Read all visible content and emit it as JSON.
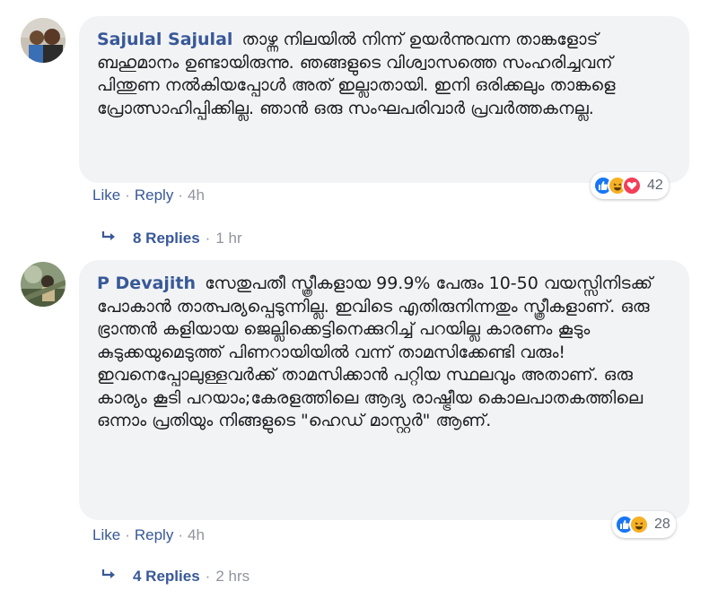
{
  "comments": [
    {
      "author": "Sajulal Sajulal",
      "text": "താഴ്ന്ന നിലയിൽ നിന്ന് ഉയർന്നുവന്ന താങ്കളോട് ബഹുമാനം ഉണ്ടായിരുന്നു. ഞങ്ങളുടെ വിശ്വാസത്തെ സംഹരിച്ചവന് പിന്തുണ നൽകിയപ്പോൾ അത് ഇല്ലാതായി. ഇനി ഒരിക്കലും താങ്കളെ പ്രോത്സാഹിപ്പിക്കില്ല. ഞാൻ ഒരു സംഘപരിവാർ പ്രവർത്തകനല്ല.",
      "reaction_count": "42",
      "like_label": "Like",
      "reply_label": "Reply",
      "time": "4h",
      "replies_label": "8 Replies",
      "replies_time": "1 hr"
    },
    {
      "author": "P Devajith",
      "text": "സേതുപതീ സ്ത്രീകളായ 99.9% പേരും 10-50 വയസ്സിനിടക്ക് പോകാൻ താത്പര്യപ്പെടുന്നില്ല. ഇവിടെ എതിരുനിന്നതും സ്ത്രീകളാണ്. ഒരു ഭ്രാന്തൻ കളിയായ ജെല്ലിക്കെട്ടിനെക്കുറിച്ച് പറയില്ല കാരണം കൂടും കുടുക്കയുമെടുത്ത് പിണറായിയിൽ വന്ന് താമസിക്കേണ്ടി വരും! ഇവനെപ്പോലുള്ളവർക്ക് താമസിക്കാൻ പറ്റിയ സ്ഥലവും അതാണ്. ഒരു കാര്യം കൂടി പറയാം;കേരളത്തിലെ ആദ്യ രാഷ്ട്രീയ കൊലപാതകത്തിലെ ഒന്നാം പ്രതിയും നിങ്ങളുടെ \"ഹെഡ് മാസ്റ്റർ\" ആണ്.",
      "reaction_count": "28",
      "like_label": "Like",
      "reply_label": "Reply",
      "time": "4h",
      "replies_label": "4 Replies",
      "replies_time": "2 hrs"
    }
  ],
  "icons": {
    "like": "like-reaction-icon",
    "haha": "haha-reaction-icon",
    "love": "love-reaction-icon",
    "reply_arrow": "reply-arrow-icon"
  },
  "colors": {
    "author": "#385898",
    "bubble": "#f2f3f5",
    "like_blue": "#1877f2",
    "haha_yellow": "#f7b125",
    "love_red": "#f33e58",
    "meta_gray": "#90949c"
  },
  "separator": "·"
}
